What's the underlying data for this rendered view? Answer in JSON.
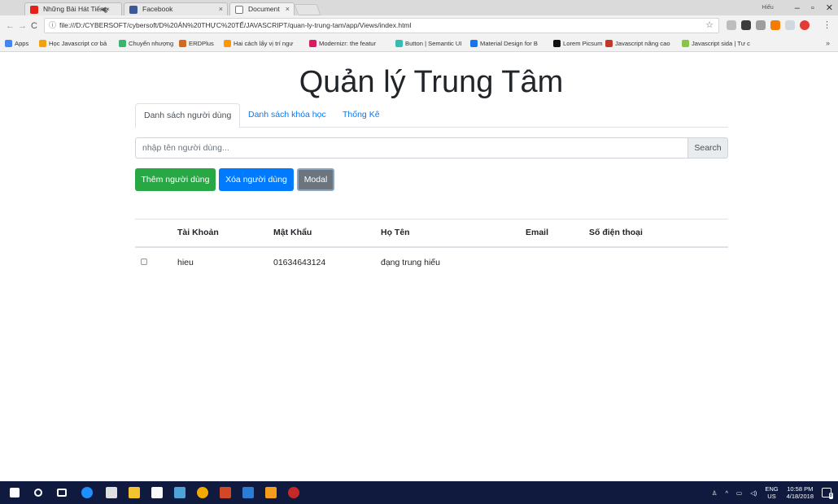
{
  "browser": {
    "tabs": [
      {
        "label": "Những Bài Hát Tiếng",
        "audio": "◀×",
        "favicon_color": "#e62117",
        "active": false
      },
      {
        "label": "Facebook",
        "favicon_color": "#3b5998",
        "active": false
      },
      {
        "label": "Document",
        "favicon_color": "#ffffff",
        "active": true
      }
    ],
    "profile_label": "Hiếu",
    "address": "file:///D:/CYBERSOFT/cybersoft/D%20ÁN%20THỰC%20TẾ/JAVASCRIPT/quan-ly-trung-tam/app/Views/index.html",
    "bookmarks": [
      {
        "label": "Apps",
        "color": "#4285f4"
      },
      {
        "label": "Học Javascript cơ bả",
        "color": "#f0a30a"
      },
      {
        "label": "Chuyển nhượng",
        "color": "#3cb371"
      },
      {
        "label": "ERDPlus",
        "color": "#d2691e"
      },
      {
        "label": "Hai cách lấy vị trí ngư",
        "color": "#ff9800"
      },
      {
        "label": "Modernizr: the featur",
        "color": "#d81b60"
      },
      {
        "label": "Button | Semantic UI",
        "color": "#35bdb2"
      },
      {
        "label": "Material Design for B",
        "color": "#1a73e8"
      },
      {
        "label": "Lorem Picsum",
        "color": "#111111"
      },
      {
        "label": "Javascript nâng cao",
        "color": "#c0392b"
      },
      {
        "label": "Javascript sida | Tư c",
        "color": "#8bc34a"
      }
    ]
  },
  "page": {
    "title": "Quản lý Trung Tâm",
    "nav_tabs": [
      {
        "label": "Danh sách người dùng",
        "active": true
      },
      {
        "label": "Danh sách khóa học",
        "active": false
      },
      {
        "label": "Thống Kê",
        "active": false
      }
    ],
    "search": {
      "placeholder": "nhập tên người dùng...",
      "value": "",
      "button_label": "Search"
    },
    "buttons": {
      "add": "Thêm người dùng",
      "delete": "Xóa người dùng",
      "modal": "Modal"
    },
    "table": {
      "headers": [
        "",
        "Tài Khoản",
        "Mật Khẩu",
        "Họ Tên",
        "Email",
        "Số điện thoại"
      ],
      "rows": [
        {
          "checked": false,
          "account": "hieu",
          "password": "01634643124",
          "name": "đạng trung hiếu",
          "email": "",
          "phone": ""
        }
      ]
    }
  },
  "taskbar": {
    "lang_top": "ENG",
    "lang_bottom": "US",
    "time": "10:58 PM",
    "date": "4/18/2018",
    "notifications": "8"
  },
  "colors": {
    "success": "#28a745",
    "primary": "#007bff",
    "secondary": "#6c757d",
    "taskbar": "#101a3e"
  }
}
